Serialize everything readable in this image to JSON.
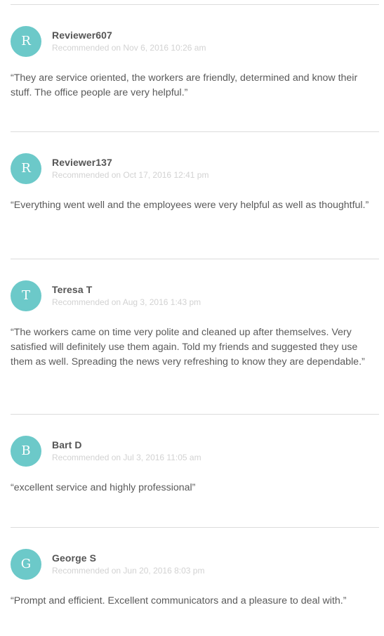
{
  "reviews": [
    {
      "initial": "R",
      "name": "Reviewer607",
      "meta": "Recommended on Nov 6, 2016 10:26 am",
      "text": "“They are service oriented, the workers are friendly, determined and know their stuff. The office people are very helpful.”"
    },
    {
      "initial": "R",
      "name": "Reviewer137",
      "meta": "Recommended on Oct 17, 2016 12:41 pm",
      "text": "“Everything went well and the employees were very helpful as well as thoughtful.”"
    },
    {
      "initial": "T",
      "name": "Teresa T",
      "meta": "Recommended on Aug 3, 2016 1:43 pm",
      "text": "“The workers came on time very polite and cleaned up after themselves. Very satisfied will definitely use them again. Told my friends and suggested they use them as well. Spreading the news very refreshing to know they are dependable.”"
    },
    {
      "initial": "B",
      "name": "Bart D",
      "meta": "Recommended on Jul 3, 2016 11:05 am",
      "text": "“excellent service and highly professional”"
    },
    {
      "initial": "G",
      "name": "George S",
      "meta": "Recommended on Jun 20, 2016 8:03 pm",
      "text": "“Prompt and efficient. Excellent communicators and a pleasure to deal with.”"
    }
  ],
  "colors": {
    "avatar_bg": "#6cc9c9",
    "divider": "#dcdcdc",
    "meta_text": "#d2d2d2",
    "body_text": "#5a5a5a"
  }
}
